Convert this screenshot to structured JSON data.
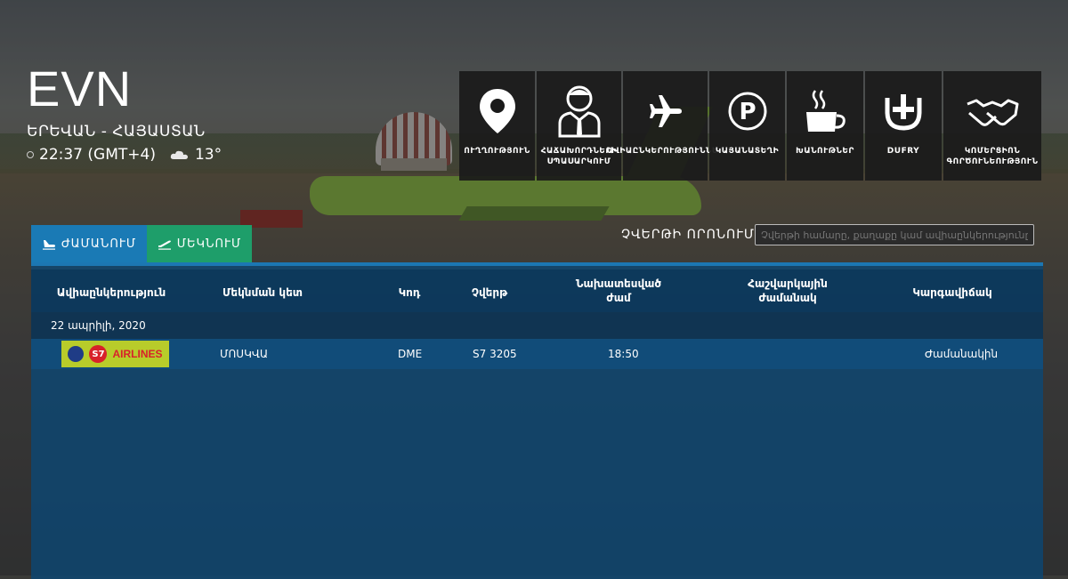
{
  "brand": {
    "code": "EVN",
    "city": "ԵՐԵՎԱՆ - ՀԱՅԱՍՏԱՆ",
    "time": "22:37 (GMT+4)",
    "temperature": "13°"
  },
  "services": [
    {
      "label": "ՈՒՂՂՈՒԹՅՈՒՆ",
      "icon": "map-pin-icon"
    },
    {
      "label": "ՀԱՃԱԽՈՐԴՆԵՐԻ ՍՊԱՍԱՐԿՈՒՄ",
      "icon": "person-tie-icon"
    },
    {
      "label": "ԱՎԻԱԸՆԿԵՐՈՒԹՅՈՒՆՆԵՐ",
      "icon": "airplane-icon"
    },
    {
      "label": "ԿԱՅԱՆԱՏԵՂԻ",
      "icon": "parking-icon"
    },
    {
      "label": "ԽԱՆՈՒԹՆԵՐ",
      "icon": "coffee-cup-icon"
    },
    {
      "label": "DUFRY",
      "icon": "dufry-icon"
    },
    {
      "label": "ԿՈՄԵՐՑԻՈՆ ԳՈՐԾՈՒՆԵՈՒԹՅՈՒՆ",
      "icon": "handshake-icon"
    }
  ],
  "tabs": {
    "arrivals": "ԺԱՄԱՆՈՒՄ",
    "departures": "ՄԵԿՆՈՒՄ"
  },
  "search": {
    "label": "ՉՎԵՐԹԻ ՈՐՈՆՈՒՄ",
    "placeholder": "Չվերթի համարը, քաղաքը կամ ավիաընկերությունը"
  },
  "table": {
    "headers": {
      "airline": "Ավիաընկերություն",
      "origin": "Մեկնման կետ",
      "code": "Կոդ",
      "flight": "Չվերթ",
      "scheduled_line1": "Նախատեսված",
      "scheduled_line2": "ժամ",
      "estimated_line1": "Հաշվարկային",
      "estimated_line2": "ժամանակ",
      "status": "Կարգավիճակ"
    },
    "date": "22 ապրիլի, 2020",
    "rows": [
      {
        "airline_logo_text": "AIRLINES",
        "airline_logo_mark": "S7",
        "origin": "ՄՈՍԿՎԱ",
        "code": "DME",
        "flight": "S7 3205",
        "scheduled": "18:50",
        "estimated": "",
        "status": "Ժամանակին"
      }
    ]
  },
  "colors": {
    "arrivals_tab": "#1a7ab5",
    "departures_tab": "#1e9e6a",
    "board": "#0a4876",
    "s7_logo_bg": "#b8cc2a"
  }
}
